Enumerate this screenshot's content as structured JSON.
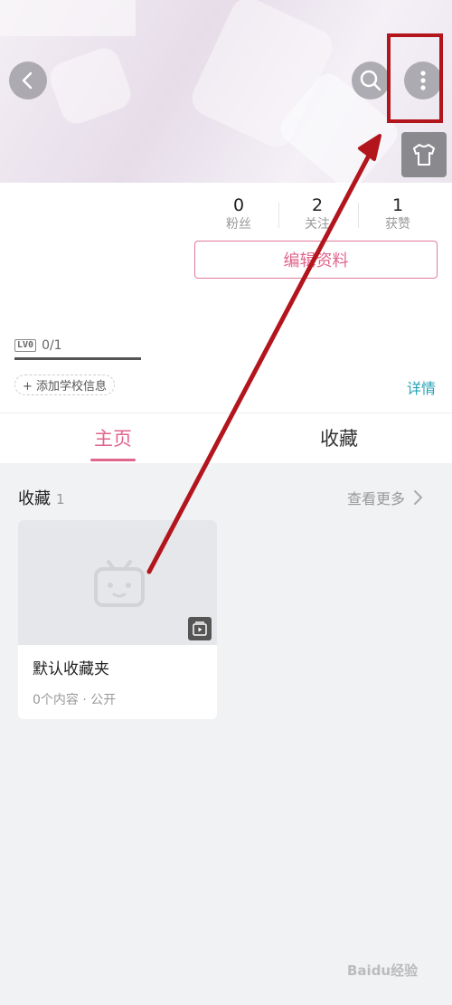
{
  "header": {
    "back_icon": "chevron-left-icon",
    "search_icon": "search-icon",
    "more_icon": "more-vertical-icon",
    "dress_icon": "tshirt-icon"
  },
  "stats": [
    {
      "value": "0",
      "label": "粉丝"
    },
    {
      "value": "2",
      "label": "关注"
    },
    {
      "value": "1",
      "label": "获赞"
    }
  ],
  "edit_profile_label": "编辑资料",
  "level": {
    "badge": "LV0",
    "progress": "0/1"
  },
  "school_label": "+ 添加学校信息",
  "details_label": "详情",
  "tabs": [
    {
      "label": "主页",
      "active": true
    },
    {
      "label": "收藏",
      "active": false
    }
  ],
  "favorites": {
    "title": "收藏",
    "count": "1",
    "more_label": "查看更多",
    "folder": {
      "name": "默认收藏夹",
      "meta": "0个内容 · 公开"
    }
  },
  "watermark": "Baidu经验",
  "colors": {
    "accent": "#e0668c",
    "link": "#26a1b6",
    "annotation": "#b3151d"
  }
}
